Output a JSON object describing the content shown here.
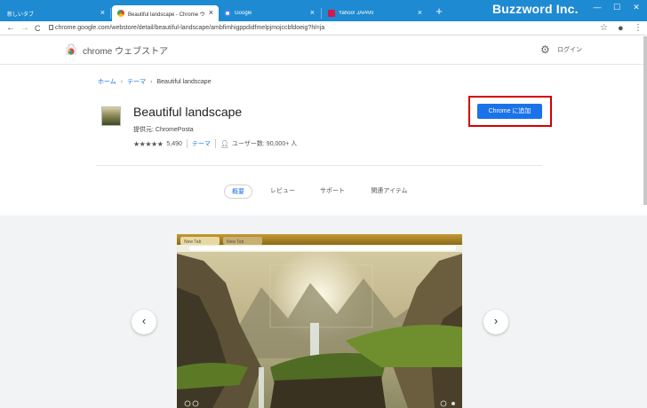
{
  "window": {
    "brand": "Buzzword Inc.",
    "controls": [
      "—",
      "☐",
      "✕"
    ],
    "tabs": [
      {
        "title": "新しいタブ",
        "close": "×",
        "active": false
      },
      {
        "title": "Beautiful landscape - Chrome ウ",
        "close": "×",
        "active": true
      },
      {
        "title": "Google",
        "close": "×",
        "active": false
      },
      {
        "title": "Yahoo! JAPAN",
        "close": "×",
        "active": false
      }
    ],
    "new_tab": "+"
  },
  "toolbar": {
    "back": "←",
    "forward": "→",
    "reload": "C",
    "url": "chrome.google.com/webstore/detail/beautiful-landscape/ambfimhigppdidfmelpjmojccbfdoeig?hl=ja",
    "star": "☆",
    "account": "●",
    "menu": "⋮"
  },
  "header": {
    "store_name": "chrome ウェブストア",
    "login": "ログイン"
  },
  "breadcrumb": {
    "home": "ホーム",
    "sep": "›",
    "theme": "テーマ",
    "current": "Beautiful landscape"
  },
  "extension": {
    "title": "Beautiful landscape",
    "provider": "提供元: ChromePosta",
    "stars": "★★★★★",
    "rating_value": 4.5,
    "rating_count": "5,490",
    "category": "テーマ",
    "users": "ユーザー数: 90,000+ 人",
    "add_button": "Chrome に追加"
  },
  "nav_tabs": [
    "概要",
    "レビュー",
    "サポート",
    "関連アイテム"
  ],
  "gallery": {
    "prev": "‹",
    "next": "›",
    "preview_tabs": [
      "New Tab",
      "New Tab"
    ]
  },
  "colors": {
    "titlebar": "#1e8ad2",
    "accent": "#1a73e8",
    "highlight": "#d40000"
  }
}
